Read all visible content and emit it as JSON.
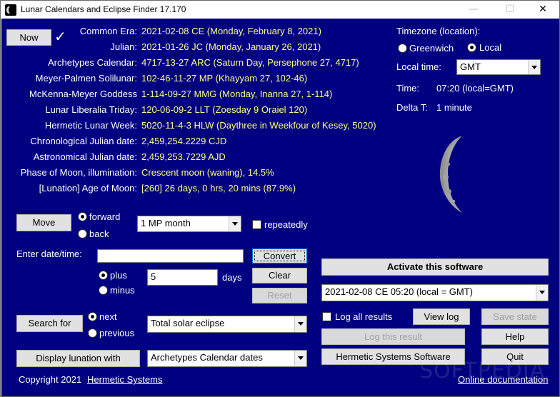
{
  "window": {
    "title": "Lunar Calendars and Eclipse Finder 17.170",
    "minimize": "—",
    "maximize": "☐",
    "close": "✕"
  },
  "now": {
    "label": "Now",
    "check": "✓"
  },
  "dates": [
    {
      "label": "Common Era:",
      "value": "2021-02-08 CE (Monday, February 8, 2021)"
    },
    {
      "label": "Julian:",
      "value": "2021-01-26 JC (Monday, January 26, 2021)"
    },
    {
      "label": "Archetypes Calendar:",
      "value": "4717-13-27 ARC (Saturn Day, Persephone 27,  4717)"
    },
    {
      "label": "Meyer-Palmen Solilunar:",
      "value": "102-46-11-27 MP (Khayyam 27, 102-46)"
    },
    {
      "label": "McKenna-Meyer Goddess",
      "value": "1-114-09-27 MMG (Monday, Inanna 27, 1-114)"
    },
    {
      "label": "Lunar Liberalia Triday:",
      "value": "120-06-09-2 LLT (Zoesday 9 Oraiel 120)"
    },
    {
      "label": "Hermetic Lunar Week:",
      "value": "5020-11-4-3 HLW (Daythree in Weekfour of Kesey, 5020)"
    },
    {
      "label": "Chronological Julian date:",
      "value": "2,459,254.2229 CJD"
    },
    {
      "label": "Astronomical Julian date:",
      "value": "2,459,253.7229 AJD"
    },
    {
      "label": "Phase of Moon, illumination:",
      "value": "Crescent moon (waning), 14.5%"
    },
    {
      "label": "[Lunation] Age of Moon:",
      "value": "[260] 26 days, 0 hrs, 20 mins (87.9%)"
    }
  ],
  "timezone": {
    "label": "Timezone (location):",
    "greenwich": "Greenwich",
    "local": "Local",
    "selected": "local",
    "local_time_label": "Local time:",
    "local_time_value": "GMT",
    "time_label": "Time:",
    "time_value": "07:20 (local=GMT)",
    "delta_label": "Delta T:",
    "delta_value": "1 minute"
  },
  "move": {
    "button": "Move",
    "forward": "forward",
    "back": "back",
    "direction": "forward",
    "unit": "1 MP month",
    "repeatedly": "repeatedly"
  },
  "enter": {
    "label": "Enter date/time:",
    "value": "",
    "convert": "Convert",
    "plus": "plus",
    "minus": "minus",
    "sign": "plus",
    "days_value": "5",
    "days_label": "days",
    "clear": "Clear",
    "reset": "Reset"
  },
  "search": {
    "button": "Search for",
    "next": "next",
    "previous": "previous",
    "direction": "next",
    "type": "Total solar eclipse"
  },
  "lunation": {
    "button": "Display lunation with",
    "type": "Archetypes Calendar dates"
  },
  "activate": {
    "button": "Activate this software",
    "result_select": "2021-02-08 CE 05:20 (local = GMT)",
    "log_all": "Log all results",
    "view_log": "View log",
    "save_state": "Save state",
    "log_result": "Log this result",
    "help": "Help",
    "hermetic": "Hermetic Systems Software",
    "quit": "Quit"
  },
  "footer": {
    "copyright": "Copyright 2021",
    "company": "Hermetic Systems",
    "docs": "Online documentation",
    "watermark": "SOFTPEDIA"
  },
  "colors": {
    "background": "#000080",
    "label": "#ffffff",
    "value": "#ffff80"
  },
  "icons": [
    "app-icon",
    "check-icon",
    "moon-icon"
  ]
}
